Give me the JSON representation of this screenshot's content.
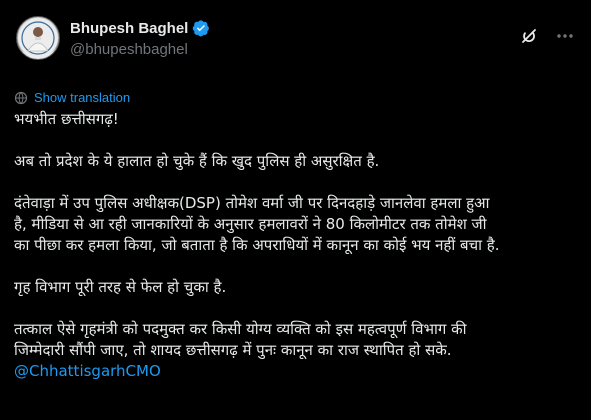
{
  "author": {
    "display_name": "Bhupesh Baghel",
    "handle": "@bhupeshbaghel",
    "verified": true,
    "avatar_icon": "profile-photo-icon",
    "verified_color": "#1d9bf0"
  },
  "actions": {
    "grok_icon": "grok-icon",
    "more_icon": "more-options-icon"
  },
  "translation": {
    "label": "Show translation",
    "icon": "translate-icon"
  },
  "tweet": {
    "line1": "भयभीत छत्तीसगढ़!",
    "line2": "अब तो प्रदेश के ये हालात हो चुके हैं कि खुद पुलिस ही असुरक्षित है.",
    "line3a": "दंतेवाड़ा में उप पुलिस अधीक्षक(DSP) तोमेश वर्मा जी पर दिनदहाड़े जानलेवा हमला हुआ",
    "line3b": "है, मीडिया से आ रही जानकारियों के अनुसार हमलावरों ने 80 किलोमीटर तक तोमेश जी",
    "line3c": "का पीछा कर हमला किया, जो बताता है कि अपराधियों में कानून का कोई भय नहीं बचा है.",
    "line4": "गृह विभाग पूरी तरह से फेल हो चुका है.",
    "line5a": "तत्काल ऐसे गृहमंत्री को पदमुक्त कर किसी योग्य व्यक्ति को इस महत्वपूर्ण विभाग की",
    "line5b": "जिम्मेदारी सौंपी जाए, तो शायद छत्तीसगढ़ में पुनः कानून का राज स्थापित हो सके.",
    "mention": "@ChhattisgarhCMO"
  },
  "colors": {
    "background": "#000000",
    "text": "#e7e9ea",
    "muted": "#71767b",
    "link": "#1d9bf0"
  }
}
